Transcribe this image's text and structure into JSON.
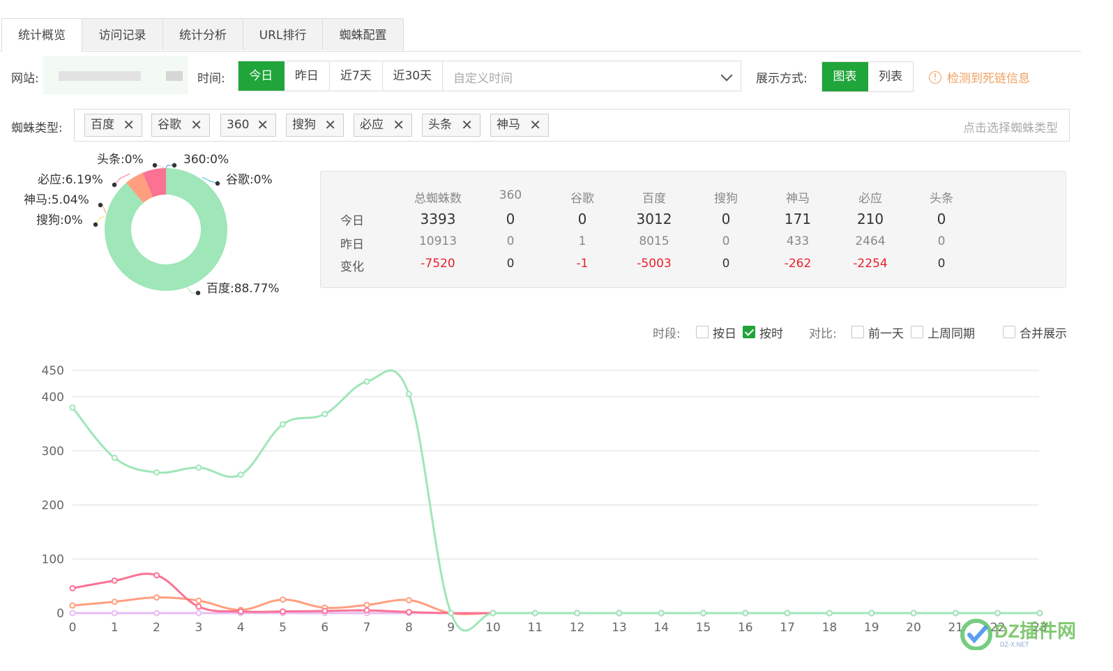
{
  "tabs": [
    "统计概览",
    "访问记录",
    "统计分析",
    "URL排行",
    "蜘蛛配置"
  ],
  "filters": {
    "site_label": "网站:",
    "time_label": "时间:",
    "time_options": [
      "今日",
      "昨日",
      "近7天",
      "近30天"
    ],
    "time_selected": "今日",
    "custom_time_placeholder": "自定义时间",
    "display_label": "展示方式:",
    "display_options": [
      "图表",
      "列表"
    ],
    "display_selected": "图表",
    "warning_text": "检测到死链信息",
    "spider_label": "蜘蛛类型:",
    "spider_tags": [
      "百度",
      "谷歌",
      "360",
      "搜狗",
      "必应",
      "头条",
      "神马"
    ],
    "spider_placeholder": "点击选择蜘蛛类型"
  },
  "pie": {
    "slices": [
      {
        "name": "百度",
        "label": "百度:88.77%",
        "value": 88.77,
        "color": "#9fe6b8"
      },
      {
        "name": "神马",
        "label": "神马:5.04%",
        "value": 5.04,
        "color": "#ff9f7f"
      },
      {
        "name": "必应",
        "label": "必应:6.19%",
        "value": 6.19,
        "color": "#fb7293"
      },
      {
        "name": "头条",
        "label": "头条:0%",
        "value": 0,
        "color": "#e7bcf3"
      },
      {
        "name": "360",
        "label": "360:0%",
        "value": 0,
        "color": "#37a2da"
      },
      {
        "name": "谷歌",
        "label": "谷歌:0%",
        "value": 0,
        "color": "#32c5e9"
      },
      {
        "name": "搜狗",
        "label": "搜狗:0%",
        "value": 0,
        "color": "#ffdb5c"
      }
    ]
  },
  "stats": {
    "headers": [
      "总蜘蛛数",
      "360",
      "谷歌",
      "百度",
      "搜狗",
      "神马",
      "必应",
      "头条"
    ],
    "rows": [
      {
        "label": "今日",
        "values": [
          "3393",
          "0",
          "0",
          "3012",
          "0",
          "171",
          "210",
          "0"
        ]
      },
      {
        "label": "昨日",
        "values": [
          "10913",
          "0",
          "1",
          "8015",
          "0",
          "433",
          "2464",
          "0"
        ]
      },
      {
        "label": "变化",
        "values": [
          "-7520",
          "0",
          "-1",
          "-5003",
          "0",
          "-262",
          "-2254",
          "0"
        ]
      }
    ]
  },
  "options": {
    "period_label": "时段:",
    "by_day": "按日",
    "by_hour": "按时",
    "compare_label": "对比:",
    "prev_day": "前一天",
    "last_week": "上周同期",
    "merge": "合并展示",
    "by_day_checked": false,
    "by_hour_checked": true,
    "prev_day_checked": false,
    "last_week_checked": false,
    "merge_checked": false
  },
  "chart_data": {
    "type": "line",
    "x": [
      "0",
      "1",
      "2",
      "3",
      "4",
      "5",
      "6",
      "7",
      "8",
      "9",
      "10",
      "11",
      "12",
      "13",
      "14",
      "15",
      "16",
      "17",
      "18",
      "19",
      "20",
      "21",
      "22",
      "23"
    ],
    "y_ticks": [
      0,
      100,
      200,
      300,
      400,
      450
    ],
    "ylim": [
      0,
      450
    ],
    "series": [
      {
        "name": "百度",
        "color": "#9fe6b8",
        "values": [
          380,
          287,
          260,
          269,
          256,
          349,
          368,
          428,
          405,
          0,
          0,
          0,
          0,
          0,
          0,
          0,
          0,
          0,
          0,
          0,
          0,
          0,
          0,
          0
        ]
      },
      {
        "name": "必应",
        "color": "#fb7293",
        "values": [
          46,
          60,
          70,
          12,
          3,
          3,
          4,
          5,
          2,
          0,
          0,
          0,
          0,
          0,
          0,
          0,
          0,
          0,
          0,
          0,
          0,
          0,
          0,
          0
        ]
      },
      {
        "name": "神马",
        "color": "#ff9f7f",
        "values": [
          14,
          21,
          29,
          23,
          6,
          25,
          10,
          15,
          24,
          0,
          0,
          0,
          0,
          0,
          0,
          0,
          0,
          0,
          0,
          0,
          0,
          0,
          0,
          0
        ]
      },
      {
        "name": "头条",
        "color": "#e7bcf3",
        "values": [
          0,
          0,
          0,
          0,
          0,
          0,
          0,
          0,
          0,
          0,
          0,
          0,
          0,
          0,
          0,
          0,
          0,
          0,
          0,
          0,
          0,
          0,
          0,
          0
        ]
      }
    ]
  },
  "watermark": {
    "text": "DZ插件网",
    "sub": "DZ-X.NET"
  }
}
